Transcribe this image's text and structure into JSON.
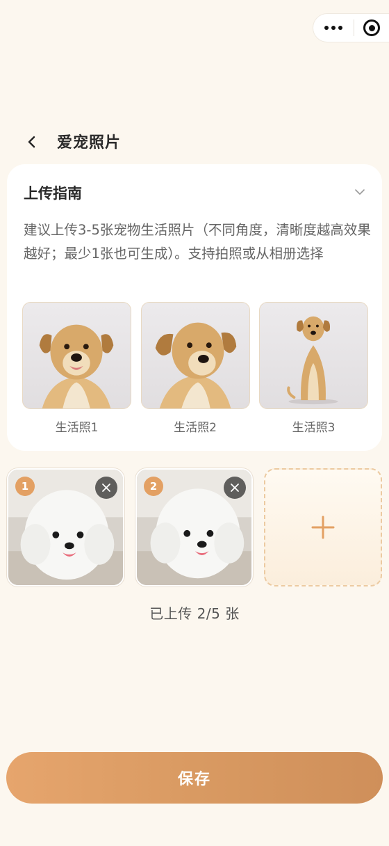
{
  "header": {
    "title": "爱宠照片"
  },
  "guide": {
    "title": "上传指南",
    "description": "建议上传3-5张宠物生活照片（不同角度，清晰度越高效果越好；最少1张也可生成）。支持拍照或从相册选择",
    "samples": [
      {
        "label": "生活照1"
      },
      {
        "label": "生活照2"
      },
      {
        "label": "生活照3"
      }
    ]
  },
  "uploads": {
    "items": [
      {
        "index": "1"
      },
      {
        "index": "2"
      }
    ],
    "count_text": "已上传 2/5 张"
  },
  "footer": {
    "save_label": "保存"
  },
  "colors": {
    "accent": "#e3a063",
    "background": "#fcf7ef",
    "button": "#d99a62"
  },
  "icons": [
    "more-icon",
    "target-icon",
    "back-icon",
    "chevron-down-icon",
    "close-icon",
    "plus-icon"
  ]
}
